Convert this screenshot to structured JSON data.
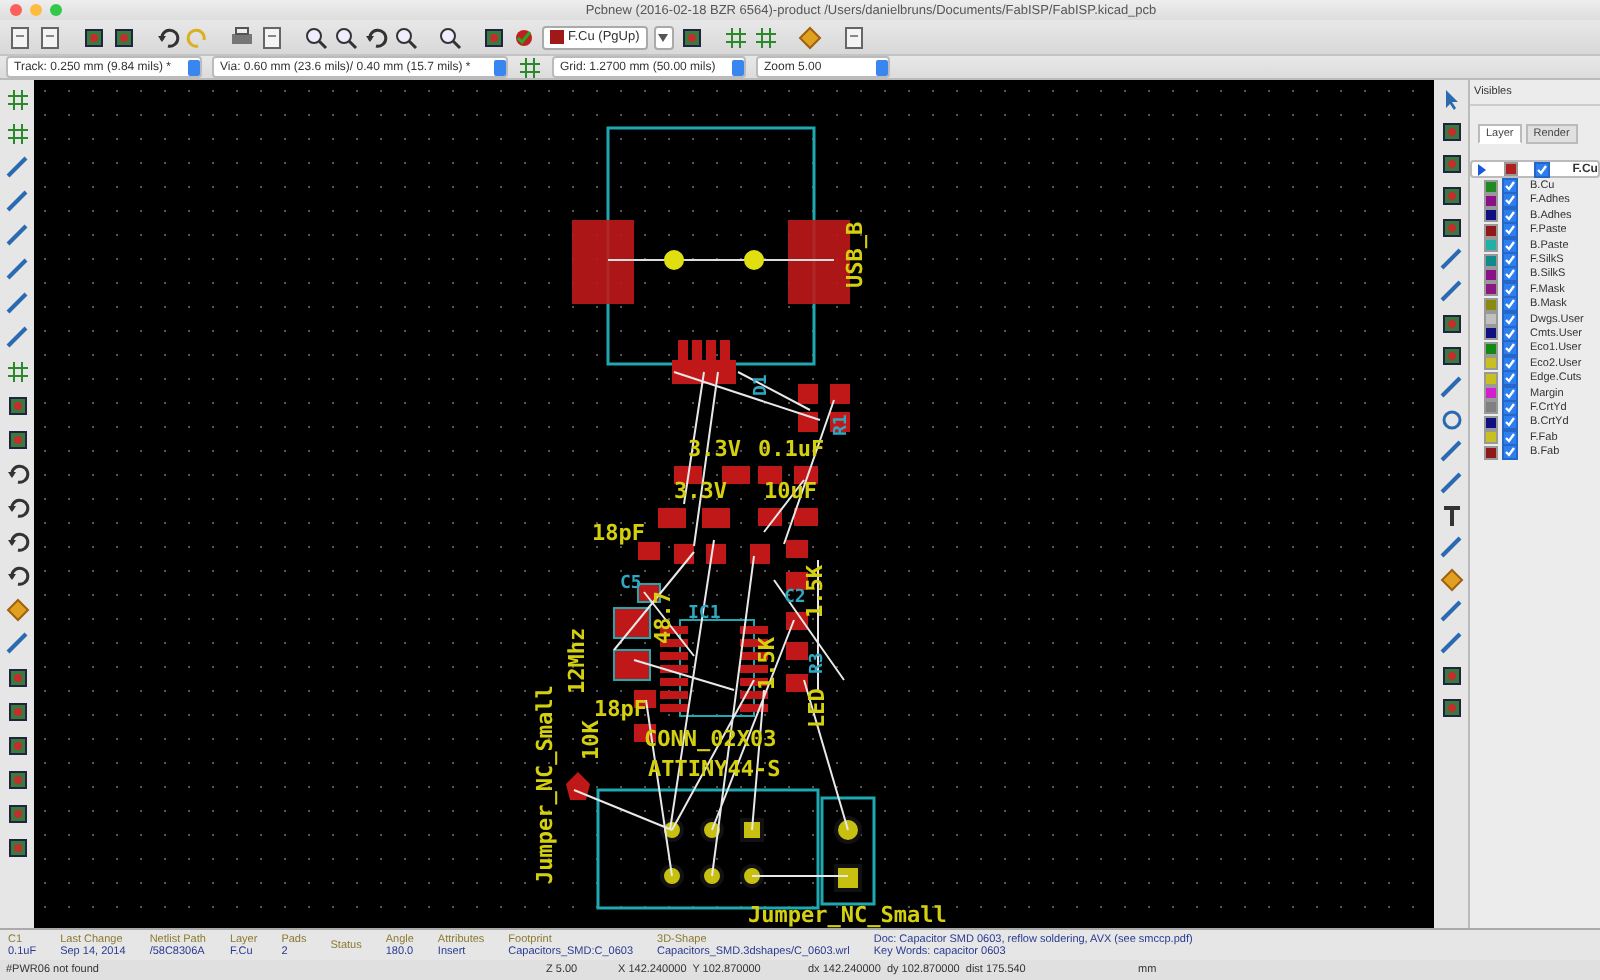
{
  "window": {
    "title": "Pcbnew (2016-02-18 BZR 6564)-product /Users/danielbruns/Documents/FabISP/FabISP.kicad_pcb"
  },
  "toolbar": {
    "layer_select": "F.Cu (PgUp)"
  },
  "options_bar": {
    "track": "Track: 0.250 mm (9.84 mils) *",
    "via": "Via: 0.60 mm (23.6 mils)/ 0.40 mm (15.7 mils) *",
    "grid": "Grid: 1.2700 mm (50.00 mils)",
    "zoom": "Zoom 5.00"
  },
  "canvas": {
    "labels": [
      {
        "text": "USB_B",
        "kind": "value"
      },
      {
        "text": "3.3V",
        "kind": "value"
      },
      {
        "text": "0.1uF",
        "kind": "value"
      },
      {
        "text": "3.3V",
        "kind": "value"
      },
      {
        "text": "10uF",
        "kind": "value"
      },
      {
        "text": "18pF",
        "kind": "value"
      },
      {
        "text": "48.7",
        "kind": "value"
      },
      {
        "text": "1.5K",
        "kind": "value"
      },
      {
        "text": "12Mhz",
        "kind": "value"
      },
      {
        "text": "1.5K",
        "kind": "value"
      },
      {
        "text": "18pF",
        "kind": "value"
      },
      {
        "text": "10K",
        "kind": "value"
      },
      {
        "text": "CONN_02X03",
        "kind": "value"
      },
      {
        "text": "ATTINY44-S",
        "kind": "value"
      },
      {
        "text": "Jumper_NC_Small",
        "kind": "value"
      },
      {
        "text": "Jumper_NC_Small",
        "kind": "value"
      },
      {
        "text": "LED",
        "kind": "value"
      },
      {
        "text": "R1",
        "kind": "ref"
      },
      {
        "text": "D1",
        "kind": "ref"
      },
      {
        "text": "C5",
        "kind": "ref"
      },
      {
        "text": "IC1",
        "kind": "ref"
      },
      {
        "text": "R3",
        "kind": "ref"
      },
      {
        "text": "C2",
        "kind": "ref"
      }
    ]
  },
  "layers_panel": {
    "title": "Visibles",
    "tabs": [
      {
        "label": "Layer",
        "selected": true
      },
      {
        "label": "Render",
        "selected": false
      }
    ],
    "layers": [
      {
        "name": "F.Cu",
        "color": "#b02020",
        "checked": true,
        "selected": true
      },
      {
        "name": "B.Cu",
        "color": "#208a20",
        "checked": true,
        "selected": false
      },
      {
        "name": "F.Adhes",
        "color": "#8a108a",
        "checked": true,
        "selected": false
      },
      {
        "name": "B.Adhes",
        "color": "#101080",
        "checked": true,
        "selected": false
      },
      {
        "name": "F.Paste",
        "color": "#901818",
        "checked": true,
        "selected": false
      },
      {
        "name": "B.Paste",
        "color": "#20b0a8",
        "checked": true,
        "selected": false
      },
      {
        "name": "F.SilkS",
        "color": "#108a8a",
        "checked": true,
        "selected": false
      },
      {
        "name": "B.SilkS",
        "color": "#8a108a",
        "checked": true,
        "selected": false
      },
      {
        "name": "F.Mask",
        "color": "#8a1880",
        "checked": true,
        "selected": false
      },
      {
        "name": "B.Mask",
        "color": "#8a8a10",
        "checked": true,
        "selected": false
      },
      {
        "name": "Dwgs.User",
        "color": "#c0c0c0",
        "checked": true,
        "selected": false
      },
      {
        "name": "Cmts.User",
        "color": "#101080",
        "checked": true,
        "selected": false
      },
      {
        "name": "Eco1.User",
        "color": "#108a10",
        "checked": true,
        "selected": false
      },
      {
        "name": "Eco2.User",
        "color": "#c8c020",
        "checked": true,
        "selected": false
      },
      {
        "name": "Edge.Cuts",
        "color": "#c8c020",
        "checked": true,
        "selected": false
      },
      {
        "name": "Margin",
        "color": "#d020d0",
        "checked": true,
        "selected": false
      },
      {
        "name": "F.CrtYd",
        "color": "#808080",
        "checked": true,
        "selected": false
      },
      {
        "name": "B.CrtYd",
        "color": "#101080",
        "checked": true,
        "selected": false
      },
      {
        "name": "F.Fab",
        "color": "#c8c020",
        "checked": true,
        "selected": false
      },
      {
        "name": "B.Fab",
        "color": "#901818",
        "checked": true,
        "selected": false
      }
    ]
  },
  "info_panel": {
    "fields": [
      {
        "label": "C1",
        "value": "0.1uF"
      },
      {
        "label": "Last Change",
        "value": "Sep 14, 2014"
      },
      {
        "label": "Netlist Path",
        "value": "/58C8306A"
      },
      {
        "label": "Layer",
        "value": "F.Cu"
      },
      {
        "label": "Pads",
        "value": "2"
      },
      {
        "label": "Status"
      },
      {
        "label": "Angle",
        "value": "180.0"
      },
      {
        "label": "Attributes",
        "value": "Insert"
      },
      {
        "label": "Footprint",
        "value": "Capacitors_SMD:C_0603"
      },
      {
        "label": "3D-Shape",
        "value": "Capacitors_SMD.3dshapes/C_0603.wrl"
      }
    ],
    "doc": "Doc: Capacitor SMD 0603, reflow soldering, AVX (see smccp.pdf)",
    "keywords": "Key Words: capacitor 0603"
  },
  "status_bar": {
    "message": "#PWR06 not found",
    "zoom": "Z 5.00",
    "position": "X 142.240000  Y 102.870000",
    "delta": "dx 142.240000  dy 102.870000  dist 175.540",
    "units": "mm"
  }
}
